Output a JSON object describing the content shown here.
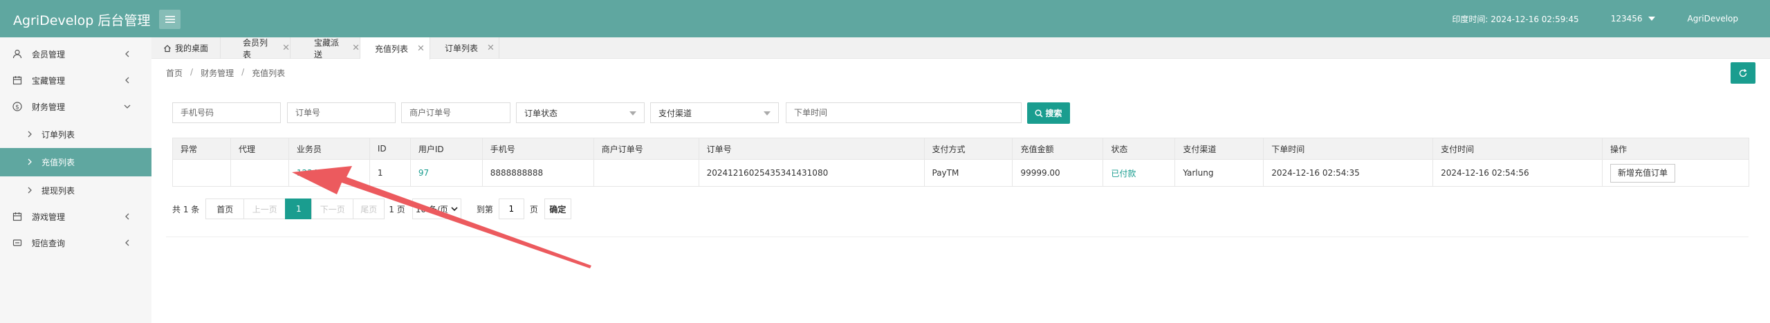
{
  "app": {
    "title": "AgriDevelop 后台管理"
  },
  "header": {
    "time_label": "印度时间: 2024-12-16 02:59:45",
    "user_id": "123456",
    "username": "AgriDevelop"
  },
  "sidebar": {
    "items": [
      {
        "label": "会员管理"
      },
      {
        "label": "宝藏管理"
      },
      {
        "label": "财务管理"
      },
      {
        "label": "订单列表"
      },
      {
        "label": "充值列表"
      },
      {
        "label": "提现列表"
      },
      {
        "label": "游戏管理"
      },
      {
        "label": "短信查询"
      }
    ]
  },
  "tabs": [
    {
      "label": "我的桌面"
    },
    {
      "label": "会员列表"
    },
    {
      "label": "宝藏派送"
    },
    {
      "label": "充值列表"
    },
    {
      "label": "订单列表"
    }
  ],
  "breadcrumb": {
    "home": "首页",
    "section": "财务管理",
    "page": "充值列表",
    "sep": "/"
  },
  "filters": {
    "phone_placeholder": "手机号码",
    "order_placeholder": "订单号",
    "merchant_order_placeholder": "商户订单号",
    "order_status": "订单状态",
    "pay_channel": "支付渠道",
    "order_time_placeholder": "下单时间",
    "search_label": "搜索"
  },
  "table": {
    "columns": [
      "异常",
      "代理",
      "业务员",
      "ID",
      "用户ID",
      "手机号",
      "商户订单号",
      "订单号",
      "支付方式",
      "充值金额",
      "状态",
      "支付渠道",
      "下单时间",
      "支付时间",
      "操作"
    ],
    "rows": [
      {
        "abnormal": "",
        "agent": "",
        "salesman": "123456",
        "id": "1",
        "user_id": "97",
        "phone": "8888888888",
        "merchant_order": "",
        "order_no": "20241216025435341431080",
        "pay_method": "PayTM",
        "amount": "99999.00",
        "status": "已付款",
        "channel": "Yarlung",
        "order_time": "2024-12-16 02:54:35",
        "pay_time": "2024-12-16 02:54:56",
        "action": "新增充值订单"
      }
    ]
  },
  "pagination": {
    "total": "共 1 条",
    "first": "首页",
    "prev": "上一页",
    "current": "1",
    "next": "下一页",
    "last": "尾页",
    "pages": "1 页",
    "page_size": "10 条/页",
    "goto_prefix": "到第",
    "goto_value": "1",
    "goto_suffix": "页",
    "confirm": "确定"
  },
  "colors": {
    "header": "#5fa7a0",
    "accent": "#1a9d8f",
    "annotation_arrow": "#ec5a5e"
  }
}
